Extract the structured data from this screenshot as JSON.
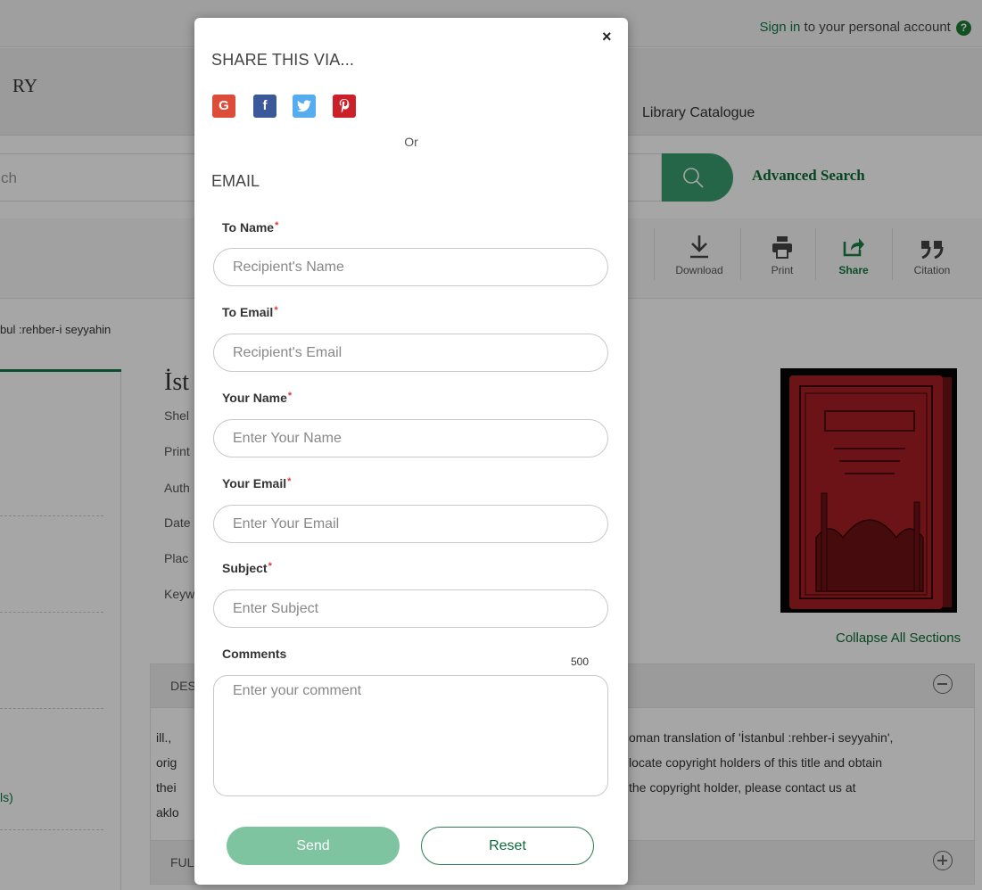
{
  "background": {
    "signin_link": "Sign in",
    "signin_rest": " to your personal account",
    "help_icon": "?",
    "logo_fragment": "RY",
    "nav_catalogue": "Library Catalogue",
    "search_fragment": "ch",
    "advanced_search": "Advanced Search",
    "toolbar": {
      "download": "Download",
      "print": "Print",
      "share": "Share",
      "citation": "Citation"
    },
    "breadcrumb_fragment": "bul :rehber-i seyyahin",
    "title_fragment": "İst",
    "meta_fragments": [
      "Shel",
      "Print",
      "Auth",
      "Date",
      "Plac",
      "Keyw"
    ],
    "collapse_all": "Collapse All Sections",
    "section_description": "DES",
    "section_full": "FUL",
    "left_link_fragment": "ls)",
    "desc_left": [
      "ill., ",
      "orig",
      "thei",
      "aklo"
    ],
    "desc_right": [
      "oman translation of 'İstanbul :rehber-i seyyahin',",
      " locate copyright holders of this title and obtain",
      " the copyright holder, please contact us at"
    ]
  },
  "modal": {
    "close_glyph": "×",
    "title": "SHARE THIS VIA...",
    "social": [
      {
        "name": "google",
        "glyph": "G",
        "color": "#dd4b39"
      },
      {
        "name": "facebook",
        "glyph": "f",
        "color": "#3b5998"
      },
      {
        "name": "twitter",
        "glyph": "t",
        "color": "#55acee"
      },
      {
        "name": "pinterest",
        "glyph": "p",
        "color": "#cb2027"
      }
    ],
    "or_text": "Or",
    "email_heading": "EMAIL",
    "fields": {
      "to_name": {
        "label": "To Name",
        "placeholder": "Recipient's Name"
      },
      "to_email": {
        "label": "To Email",
        "placeholder": "Recipient's Email"
      },
      "your_name": {
        "label": "Your Name",
        "placeholder": "Enter Your Name"
      },
      "your_email": {
        "label": "Your Email",
        "placeholder": "Enter Your Email"
      },
      "subject": {
        "label": "Subject",
        "placeholder": "Enter Subject"
      },
      "comments": {
        "label": "Comments",
        "placeholder": "Enter your comment",
        "counter": "500"
      }
    },
    "required_mark": "*",
    "send_label": "Send",
    "reset_label": "Reset"
  }
}
